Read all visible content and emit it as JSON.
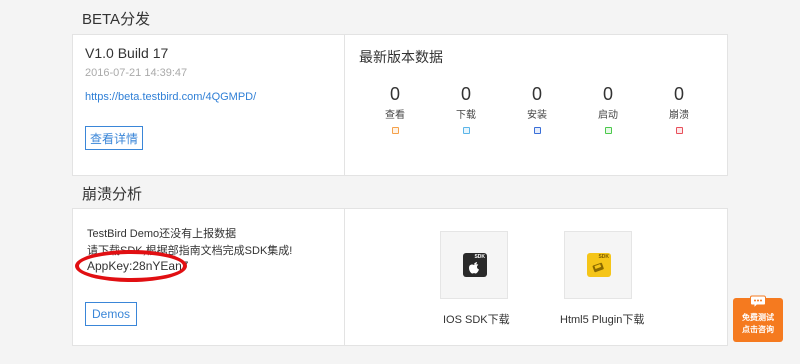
{
  "beta": {
    "section_title": "BETA分发",
    "version": "V1.0 Build 17",
    "date": "2016-07-21 14:39:47",
    "link": "https://beta.testbird.com/4QGMPD/",
    "details_button": "查看详情",
    "stats_title": "最新版本数据",
    "stats": [
      {
        "value": "0",
        "label": "查看",
        "color": "#f5a14b"
      },
      {
        "value": "0",
        "label": "下载",
        "color": "#5bb5e8"
      },
      {
        "value": "0",
        "label": "安装",
        "color": "#3a6fd8"
      },
      {
        "value": "0",
        "label": "启动",
        "color": "#4cc94c"
      },
      {
        "value": "0",
        "label": "崩溃",
        "color": "#e8505b"
      }
    ]
  },
  "crash": {
    "section_title": "崩溃分析",
    "line1": "TestBird Demo还没有上报数据",
    "line2": "请下载SDK,根据部指南文档完成SDK集成!",
    "appkey": "AppKey:28nYEan7",
    "demos_button": "Demos",
    "ios_sdk": {
      "badge": "SDK",
      "label": "IOS SDK下载"
    },
    "html5_sdk": {
      "badge": "SDK",
      "label": "Html5 Plugin下载"
    }
  },
  "float_help": {
    "line1": "免费测试",
    "line2": "点击咨询"
  }
}
